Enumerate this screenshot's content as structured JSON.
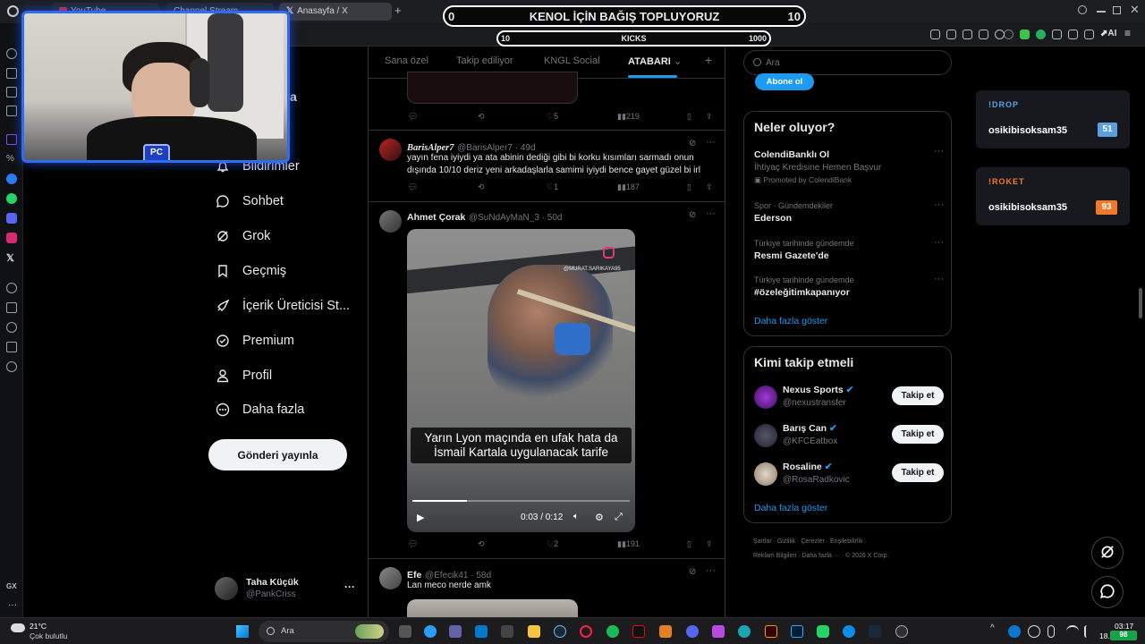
{
  "browser": {
    "tabs": [
      {
        "label": "YouTube"
      },
      {
        "label": "Channel Stream"
      },
      {
        "label": "Anasayfa / X"
      }
    ],
    "new_tab": "+"
  },
  "overlay": {
    "donate_left": "0",
    "donate_title": "KENOL İÇİN BAĞIŞ TOPLUYORUZ",
    "donate_right": "10",
    "kicks_left": "10",
    "kicks_title": "KICKS",
    "kicks_right": "1000"
  },
  "sidebar": {
    "partial_letter": "a",
    "items": [
      {
        "label": "Bildirimler",
        "icon": "bell-icon"
      },
      {
        "label": "Sohbet",
        "icon": "chat-icon"
      },
      {
        "label": "Grok",
        "icon": "grok-icon"
      },
      {
        "label": "Geçmiş",
        "icon": "bookmark-icon"
      },
      {
        "label": "İçerik Üreticisi St...",
        "icon": "rocket-icon"
      },
      {
        "label": "Premium",
        "icon": "verified-icon"
      },
      {
        "label": "Profil",
        "icon": "person-icon"
      },
      {
        "label": "Daha fazla",
        "icon": "more-circle-icon"
      }
    ],
    "post_button": "Gönderi yayınla",
    "account": {
      "name": "Taha Küçük",
      "handle": "@PankCriss",
      "more": "···"
    }
  },
  "feed": {
    "tabs": [
      {
        "label": "Sana özel"
      },
      {
        "label": "Takip ediliyor"
      },
      {
        "label": "KNGL Social"
      },
      {
        "label": "ATABARI"
      }
    ],
    "add": "+",
    "tweets": [
      {
        "stats": {
          "replies": "",
          "retweets": "",
          "likes": "5",
          "views": "219"
        }
      },
      {
        "name": "BarisAlper7",
        "handle": "@BarisAlper7 · 49d",
        "text": "yayın fena iyiydi ya ata abinin dediği gibi bi korku kısımları sarmadı onun dışında 10/10 deriz yeni arkadaşlarla samimi iyiydi bence gayet güzel bi irl",
        "stats": {
          "replies": "",
          "retweets": "",
          "likes": "1",
          "views": "187"
        }
      },
      {
        "name": "Ahmet Çorak",
        "handle": "@SuNdAyMaN_3 · 50d",
        "video": {
          "watermark": "@MURAT.SARIKAYA95",
          "caption_line1": "Yarın Lyon maçında en ufak hata da",
          "caption_line2": "İsmail Kartala uygulanacak tarife",
          "time": "0:03 / 0:12",
          "progress": 0.25
        },
        "stats": {
          "replies": "",
          "retweets": "",
          "likes": "2",
          "views": "191"
        }
      },
      {
        "name": "Efe",
        "handle": "@Efecik41 · 58d",
        "text": "Lan meco nerde amk"
      }
    ]
  },
  "right": {
    "search_placeholder": "Ara",
    "subscribe": "Abone ol",
    "trends": {
      "title": "Neler oluyor?",
      "items": [
        {
          "name": "ColendiBanklı Ol",
          "sub": "İhtiyaç Kredisine Hemen Başvur",
          "promo": "Promoted by ColendiBank"
        },
        {
          "meta": "Spor · Gündemdekiler",
          "name": "Ederson"
        },
        {
          "meta": "Türkiye tarihinde gündemde",
          "name": "Resmi Gazete'de"
        },
        {
          "meta": "Türkiye tarihinde gündemde",
          "name": "#özeleğitimkapanıyor"
        }
      ],
      "more": "Daha fazla göster"
    },
    "who_to_follow": {
      "title": "Kimi takip etmeli",
      "items": [
        {
          "name": "Nexus Sports",
          "handle": "@nexustransfer",
          "button": "Takip et"
        },
        {
          "name": "Barış Can",
          "handle": "@KFCEatbox",
          "button": "Takip et"
        },
        {
          "name": "Rosaline",
          "handle": "@RosaRadkovic",
          "button": "Takip et"
        }
      ],
      "more": "Daha fazla göster"
    },
    "footer": {
      "line1": [
        "Şartlar",
        "Gizlilik",
        "Çerezler",
        "Erişilebilirlik"
      ],
      "line2": [
        "Reklam Bilgileri",
        "Daha fazla ···",
        "© 2026 X Corp."
      ]
    }
  },
  "widgets": {
    "drop": {
      "title": "!DROP",
      "user": "osikibisoksam35",
      "value": "51"
    },
    "roket": {
      "title": "!ROKET",
      "user": "osikibisoksam35",
      "value": "93"
    }
  },
  "taskbar": {
    "weather_temp": "21°C",
    "weather_desc": "Çok bulutlu",
    "search": "Ara",
    "time": "03:17",
    "date": "18.",
    "badge": "98"
  },
  "leftbar_bottom": "GX",
  "colors": {
    "accent": "#1d9bf0",
    "drop_badge": "#5aa0e0",
    "roket_badge": "#f07a2a"
  }
}
